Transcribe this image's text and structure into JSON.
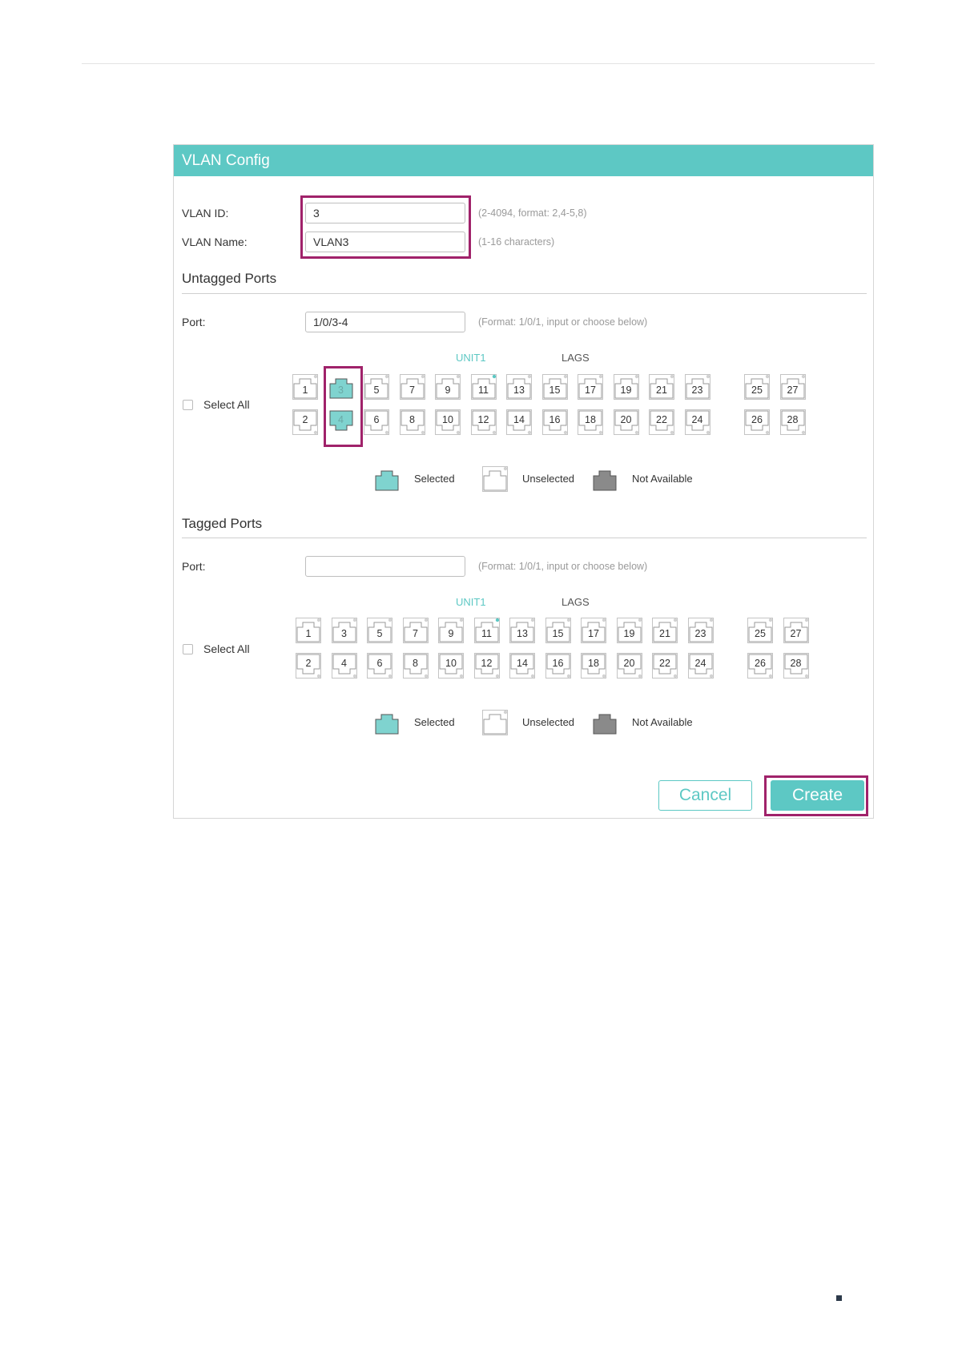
{
  "window": {
    "title": "VLAN Config"
  },
  "vlan": {
    "id_label": "VLAN ID:",
    "id_value": "3",
    "id_hint": "(2-4094, format: 2,4-5,8)",
    "name_label": "VLAN Name:",
    "name_value": "VLAN3",
    "name_hint": "(1-16 characters)"
  },
  "untagged": {
    "title": "Untagged Ports",
    "port_label": "Port:",
    "port_value": "1/0/3-4",
    "port_hint": "(Format: 1/0/1, input or choose below)",
    "unit_label": "UNIT1",
    "lags_label": "LAGS",
    "select_all": "Select All",
    "ports": [
      {
        "n": "1",
        "state": "unselected"
      },
      {
        "n": "2",
        "state": "unselected"
      },
      {
        "n": "3",
        "state": "selected"
      },
      {
        "n": "4",
        "state": "selected"
      },
      {
        "n": "5",
        "state": "unselected"
      },
      {
        "n": "6",
        "state": "unselected"
      },
      {
        "n": "7",
        "state": "unselected"
      },
      {
        "n": "8",
        "state": "unselected"
      },
      {
        "n": "9",
        "state": "unselected"
      },
      {
        "n": "10",
        "state": "unselected"
      },
      {
        "n": "11",
        "state": "unselected",
        "link": true
      },
      {
        "n": "12",
        "state": "unselected"
      },
      {
        "n": "13",
        "state": "unselected"
      },
      {
        "n": "14",
        "state": "unselected"
      },
      {
        "n": "15",
        "state": "unselected"
      },
      {
        "n": "16",
        "state": "unselected"
      },
      {
        "n": "17",
        "state": "unselected"
      },
      {
        "n": "18",
        "state": "unselected"
      },
      {
        "n": "19",
        "state": "unselected"
      },
      {
        "n": "20",
        "state": "unselected"
      },
      {
        "n": "21",
        "state": "unselected"
      },
      {
        "n": "22",
        "state": "unselected"
      },
      {
        "n": "23",
        "state": "unselected"
      },
      {
        "n": "24",
        "state": "unselected"
      },
      {
        "n": "25",
        "state": "unselected"
      },
      {
        "n": "26",
        "state": "unselected"
      },
      {
        "n": "27",
        "state": "unselected"
      },
      {
        "n": "28",
        "state": "unselected"
      }
    ]
  },
  "tagged": {
    "title": "Tagged Ports",
    "port_label": "Port:",
    "port_value": "",
    "port_hint": "(Format: 1/0/1, input or choose below)",
    "unit_label": "UNIT1",
    "lags_label": "LAGS",
    "select_all": "Select All",
    "ports": [
      {
        "n": "1",
        "state": "unselected"
      },
      {
        "n": "2",
        "state": "unselected"
      },
      {
        "n": "3",
        "state": "unselected"
      },
      {
        "n": "4",
        "state": "unselected"
      },
      {
        "n": "5",
        "state": "unselected"
      },
      {
        "n": "6",
        "state": "unselected"
      },
      {
        "n": "7",
        "state": "unselected"
      },
      {
        "n": "8",
        "state": "unselected"
      },
      {
        "n": "9",
        "state": "unselected"
      },
      {
        "n": "10",
        "state": "unselected"
      },
      {
        "n": "11",
        "state": "unselected",
        "link": true
      },
      {
        "n": "12",
        "state": "unselected"
      },
      {
        "n": "13",
        "state": "unselected"
      },
      {
        "n": "14",
        "state": "unselected"
      },
      {
        "n": "15",
        "state": "unselected"
      },
      {
        "n": "16",
        "state": "unselected"
      },
      {
        "n": "17",
        "state": "unselected"
      },
      {
        "n": "18",
        "state": "unselected"
      },
      {
        "n": "19",
        "state": "unselected"
      },
      {
        "n": "20",
        "state": "unselected"
      },
      {
        "n": "21",
        "state": "unselected"
      },
      {
        "n": "22",
        "state": "unselected"
      },
      {
        "n": "23",
        "state": "unselected"
      },
      {
        "n": "24",
        "state": "unselected"
      },
      {
        "n": "25",
        "state": "unselected"
      },
      {
        "n": "26",
        "state": "unselected"
      },
      {
        "n": "27",
        "state": "unselected"
      },
      {
        "n": "28",
        "state": "unselected"
      }
    ]
  },
  "legend": {
    "selected": "Selected",
    "unselected": "Unselected",
    "not_available": "Not Available"
  },
  "buttons": {
    "cancel": "Cancel",
    "create": "Create"
  },
  "colors": {
    "accent": "#5dc8c4",
    "selected_fill": "#7fd3cf",
    "not_available_fill": "#8a8a8a",
    "highlight": "#a0226a",
    "link_dot": "#5dc8c4"
  },
  "icons": {
    "port": "ethernet-port-icon",
    "checkbox": "checkbox-icon"
  }
}
